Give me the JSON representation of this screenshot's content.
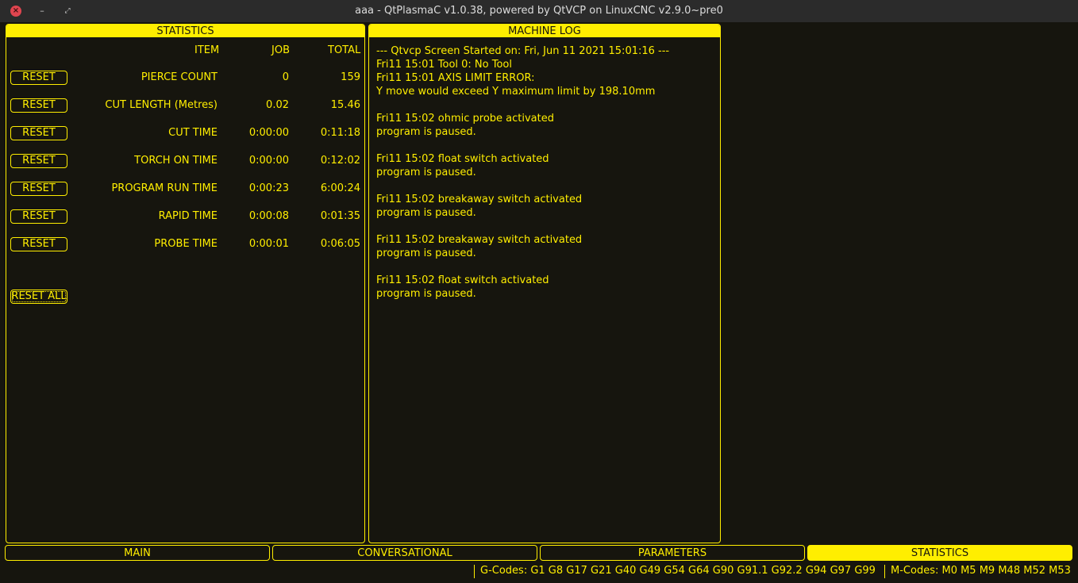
{
  "window": {
    "title": "aaa - QtPlasmaC v1.0.38, powered by QtVCP on LinuxCNC v2.9.0~pre0",
    "close_glyph": "×",
    "minimize_glyph": "–",
    "maximize_glyph": "⤢"
  },
  "statistics": {
    "header": "STATISTICS",
    "columns": {
      "item": "ITEM",
      "job": "JOB",
      "total": "TOTAL"
    },
    "reset_label": "RESET",
    "rows": [
      {
        "item": "PIERCE COUNT",
        "job": "0",
        "total": "159"
      },
      {
        "item": "CUT LENGTH (Metres)",
        "job": "0.02",
        "total": "15.46"
      },
      {
        "item": "CUT TIME",
        "job": "0:00:00",
        "total": "0:11:18"
      },
      {
        "item": "TORCH ON TIME",
        "job": "0:00:00",
        "total": "0:12:02"
      },
      {
        "item": "PROGRAM RUN TIME",
        "job": "0:00:23",
        "total": "6:00:24"
      },
      {
        "item": "RAPID TIME",
        "job": "0:00:08",
        "total": "0:01:35"
      },
      {
        "item": "PROBE TIME",
        "job": "0:00:01",
        "total": "0:06:05"
      }
    ],
    "reset_all_label": "RESET ALL"
  },
  "machine_log": {
    "header": "MACHINE LOG",
    "lines": [
      "--- Qtvcp Screen Started on: Fri, Jun 11 2021 15:01:16 ---",
      "Fri11 15:01 Tool 0: No Tool",
      "Fri11 15:01 AXIS LIMIT ERROR:",
      "Y move would exceed Y maximum limit by 198.10mm",
      "",
      "Fri11 15:02 ohmic probe activated",
      "program is paused.",
      "",
      "Fri11 15:02 float switch activated",
      "program is paused.",
      "",
      "Fri11 15:02 breakaway switch activated",
      "program is paused.",
      "",
      "Fri11 15:02 breakaway switch activated",
      "program is paused.",
      "",
      "Fri11 15:02 float switch activated",
      "program is paused."
    ]
  },
  "tabs": [
    {
      "label": "MAIN",
      "active": false
    },
    {
      "label": "CONVERSATIONAL",
      "active": false
    },
    {
      "label": "PARAMETERS",
      "active": false
    },
    {
      "label": "STATISTICS",
      "active": true
    }
  ],
  "status_bar": {
    "gcodes": "G-Codes: G1 G8 G17 G21 G40 G49 G54 G64 G90 G91.1 G92.2 G94 G97 G99",
    "mcodes": "M-Codes: M0 M5 M9 M48 M52 M53"
  },
  "colors": {
    "accent": "#ffee00",
    "background": "#16150e",
    "titlebar": "#2b2b2b",
    "close_button": "#e0454f"
  }
}
